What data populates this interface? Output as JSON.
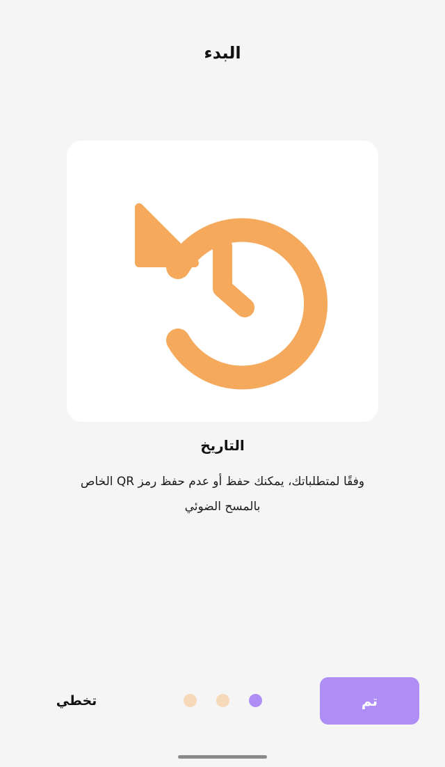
{
  "header": {
    "title": "البدء"
  },
  "illustration": {
    "icon": "history-icon",
    "icon_color": "#f4a95c",
    "card_background": "#ffffff"
  },
  "feature": {
    "title": "التاريخ",
    "description": "وفقًا لمتطلباتك، يمكنك حفظ أو عدم حفظ رمز QR الخاص بالمسح الضوئي"
  },
  "footer": {
    "skip_label": "تخطي",
    "done_label": "تم",
    "done_color": "#ae8df5",
    "pagination": {
      "total": 3,
      "active_index": 2,
      "active_color": "#ae8df5",
      "inactive_color": "#f6d9b8"
    }
  }
}
